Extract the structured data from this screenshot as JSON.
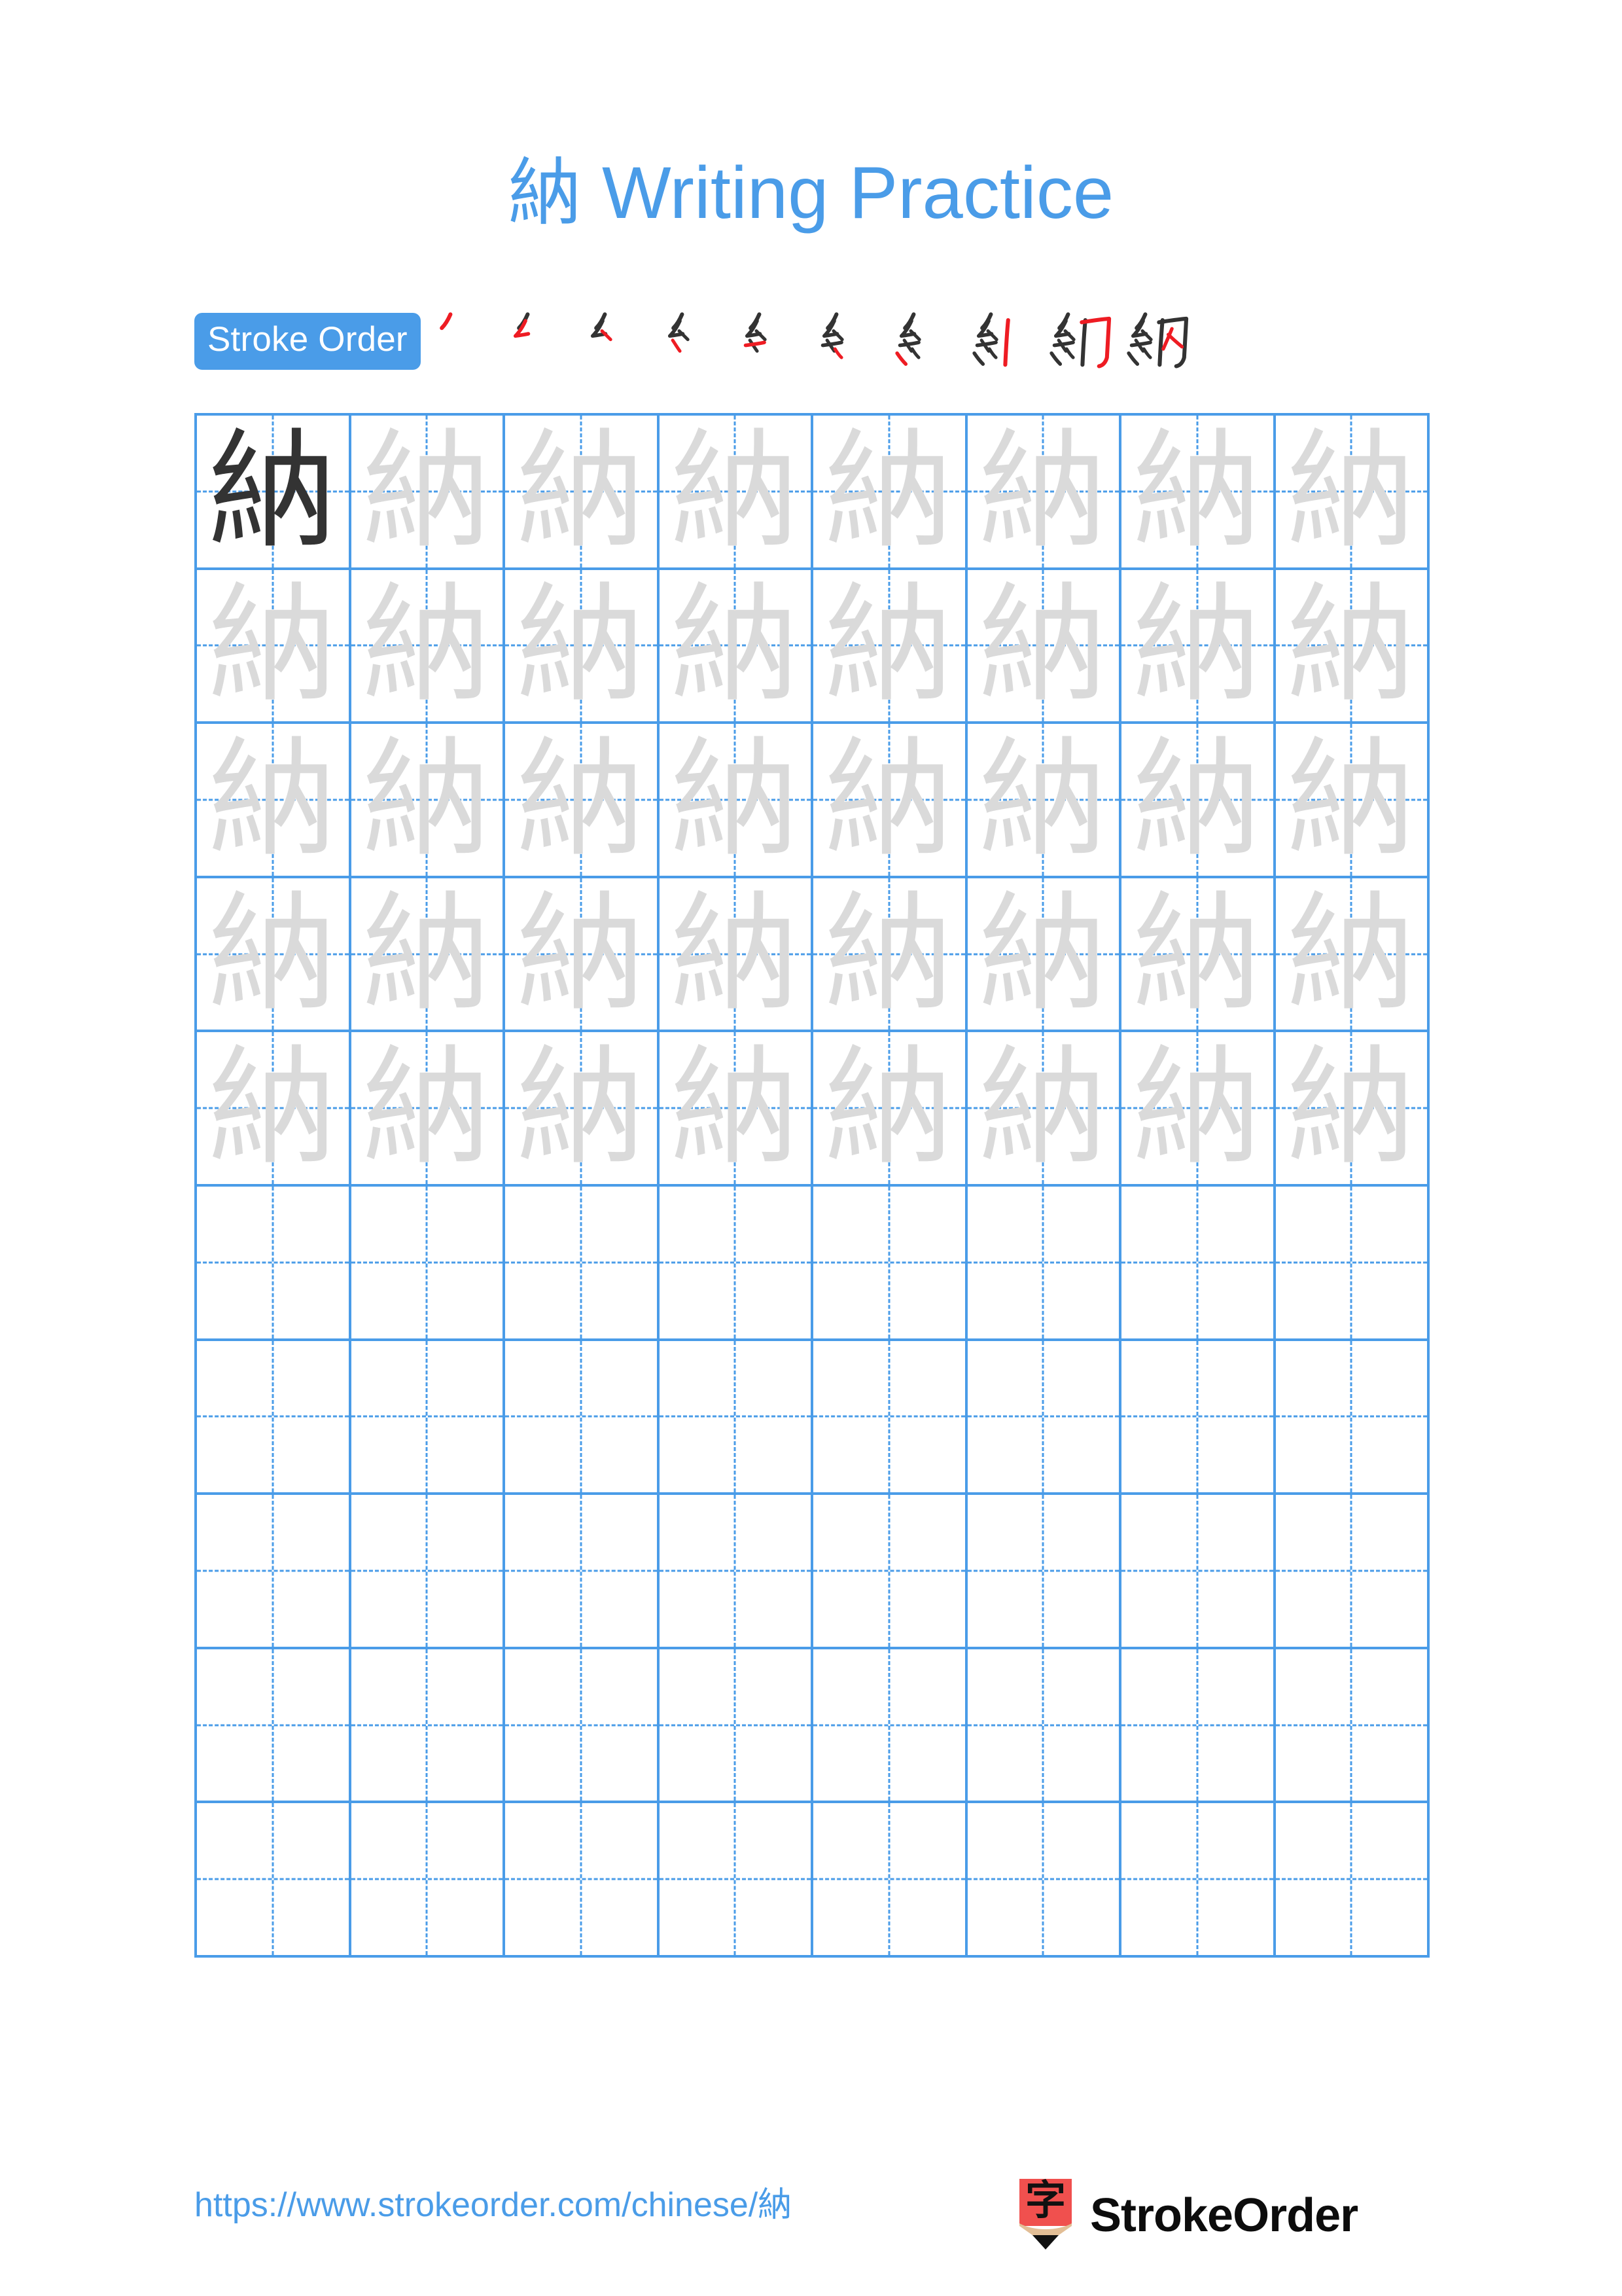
{
  "document": {
    "character": "納",
    "title": "納 Writing Practice",
    "title_character": "納",
    "title_text": " Writing Practice"
  },
  "stroke_order": {
    "badge_label": "Stroke Order",
    "total_strokes": 10,
    "active_stroke_color": "#EE1C23",
    "drawn_stroke_color": "#333333",
    "steps": [
      {
        "index": 1,
        "strokes_shown": 1,
        "new_stroke": 1
      },
      {
        "index": 2,
        "strokes_shown": 2,
        "new_stroke": 2
      },
      {
        "index": 3,
        "strokes_shown": 3,
        "new_stroke": 3
      },
      {
        "index": 4,
        "strokes_shown": 4,
        "new_stroke": 4
      },
      {
        "index": 5,
        "strokes_shown": 5,
        "new_stroke": 5
      },
      {
        "index": 6,
        "strokes_shown": 6,
        "new_stroke": 6
      },
      {
        "index": 7,
        "strokes_shown": 7,
        "new_stroke": 7
      },
      {
        "index": 8,
        "strokes_shown": 8,
        "new_stroke": 8
      },
      {
        "index": 9,
        "strokes_shown": 9,
        "new_stroke": 9
      },
      {
        "index": 10,
        "strokes_shown": 10,
        "new_stroke": 10
      }
    ]
  },
  "practice_grid": {
    "columns": 8,
    "rows": 10,
    "grid_line_color": "#4A9CE8",
    "example_char_color": "#333333",
    "trace_char_color": "#DADADA",
    "cells": [
      [
        "example",
        "trace",
        "trace",
        "trace",
        "trace",
        "trace",
        "trace",
        "trace"
      ],
      [
        "trace",
        "trace",
        "trace",
        "trace",
        "trace",
        "trace",
        "trace",
        "trace"
      ],
      [
        "trace",
        "trace",
        "trace",
        "trace",
        "trace",
        "trace",
        "trace",
        "trace"
      ],
      [
        "trace",
        "trace",
        "trace",
        "trace",
        "trace",
        "trace",
        "trace",
        "trace"
      ],
      [
        "trace",
        "trace",
        "trace",
        "trace",
        "trace",
        "trace",
        "trace",
        "trace"
      ],
      [
        "empty",
        "empty",
        "empty",
        "empty",
        "empty",
        "empty",
        "empty",
        "empty"
      ],
      [
        "empty",
        "empty",
        "empty",
        "empty",
        "empty",
        "empty",
        "empty",
        "empty"
      ],
      [
        "empty",
        "empty",
        "empty",
        "empty",
        "empty",
        "empty",
        "empty",
        "empty"
      ],
      [
        "empty",
        "empty",
        "empty",
        "empty",
        "empty",
        "empty",
        "empty",
        "empty"
      ],
      [
        "empty",
        "empty",
        "empty",
        "empty",
        "empty",
        "empty",
        "empty",
        "empty"
      ]
    ]
  },
  "footer": {
    "url": "https://www.strokeorder.com/chinese/納",
    "brand_name": "StrokeOrder",
    "logo_character": "字",
    "logo_body_color": "#F0504E",
    "logo_wood_color": "#E2BE96",
    "logo_tip_color": "#111111"
  },
  "colors": {
    "accent_blue": "#4A9CE8",
    "red": "#EE1C23",
    "dark": "#333333",
    "light_gray": "#DADADA",
    "background": "#FFFFFF"
  }
}
